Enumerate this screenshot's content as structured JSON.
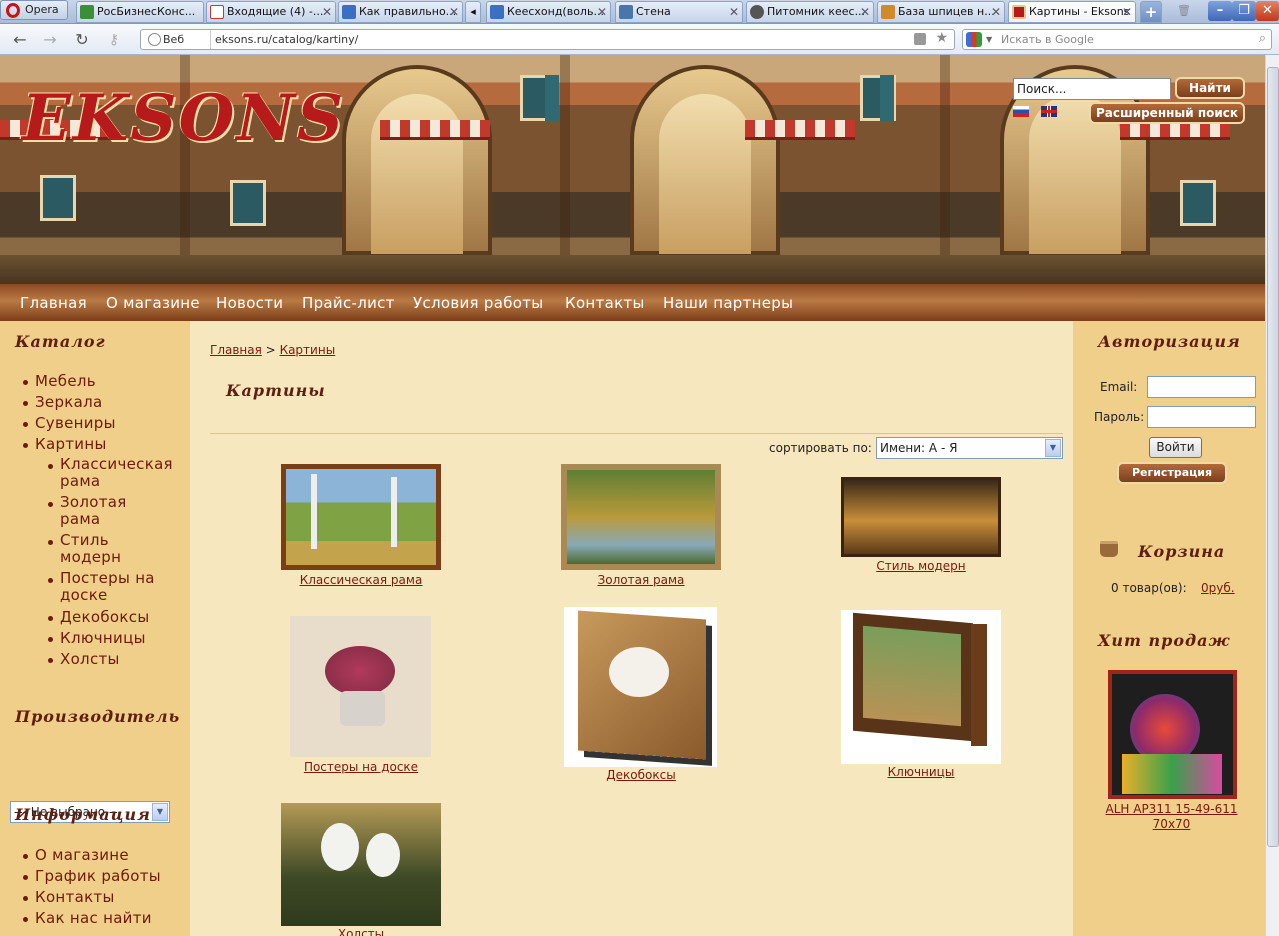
{
  "browser": {
    "menu_label": "Opera",
    "tabs": [
      {
        "label": "РосБизнесКонс..."
      },
      {
        "label": "Входящие (4) -..."
      },
      {
        "label": "Как правильно..."
      },
      {
        "label": "Кеесхонд(воль..."
      },
      {
        "label": "Стена"
      },
      {
        "label": "Питомник кеес..."
      },
      {
        "label": "База шпицев н..."
      },
      {
        "label": "Картины - Eksons"
      }
    ],
    "web_label": "Веб",
    "url": "eksons.ru/catalog/kartiny/",
    "search_placeholder": "Искать в Google"
  },
  "site": {
    "logo": "EKSONS",
    "search_value": "Поиск...",
    "search_button": "Найти",
    "advanced_search": "Расширенный поиск",
    "nav": [
      "Главная",
      "О магазине",
      "Новости",
      "Прайс-лист",
      "Условия работы",
      "Контакты",
      "Наши партнеры"
    ]
  },
  "left": {
    "catalog_title": "Каталог",
    "catalog": [
      "Мебель",
      "Зеркала",
      "Сувениры",
      "Картины"
    ],
    "sub": [
      "Классическая рама",
      "Золотая рама",
      "Стиль модерн",
      "Постеры на доске",
      "Декобоксы",
      "Ключницы",
      "Холсты"
    ],
    "maker_title": "Производитель",
    "maker_select": "--- Не выбрано ---",
    "info_title": "Информация",
    "info": [
      "О магазине",
      "График работы",
      "Контакты",
      "Как нас найти"
    ]
  },
  "main": {
    "crumb_home": "Главная",
    "crumb_sep": ">",
    "crumb_current": "Картины",
    "title": "Картины",
    "sort_label": "сортировать по:",
    "sort_value": "Имени: А - Я",
    "products": [
      "Классическая рама",
      "Золотая рама",
      "Стиль модерн",
      "Постеры на доске",
      "Декобоксы",
      "Ключницы",
      "Холсты"
    ]
  },
  "right": {
    "auth_title": "Авторизация",
    "email_label": "Email:",
    "password_label": "Пароль:",
    "login_button": "Войти",
    "register_button": "Регистрация",
    "cart_title": "Корзина",
    "cart_items": "0 товар(ов):",
    "cart_sum": "0руб.",
    "hits_title": "Хит продаж",
    "hit_name_line1": "ALH AP311 15-49-611",
    "hit_name_line2": "70x70"
  }
}
